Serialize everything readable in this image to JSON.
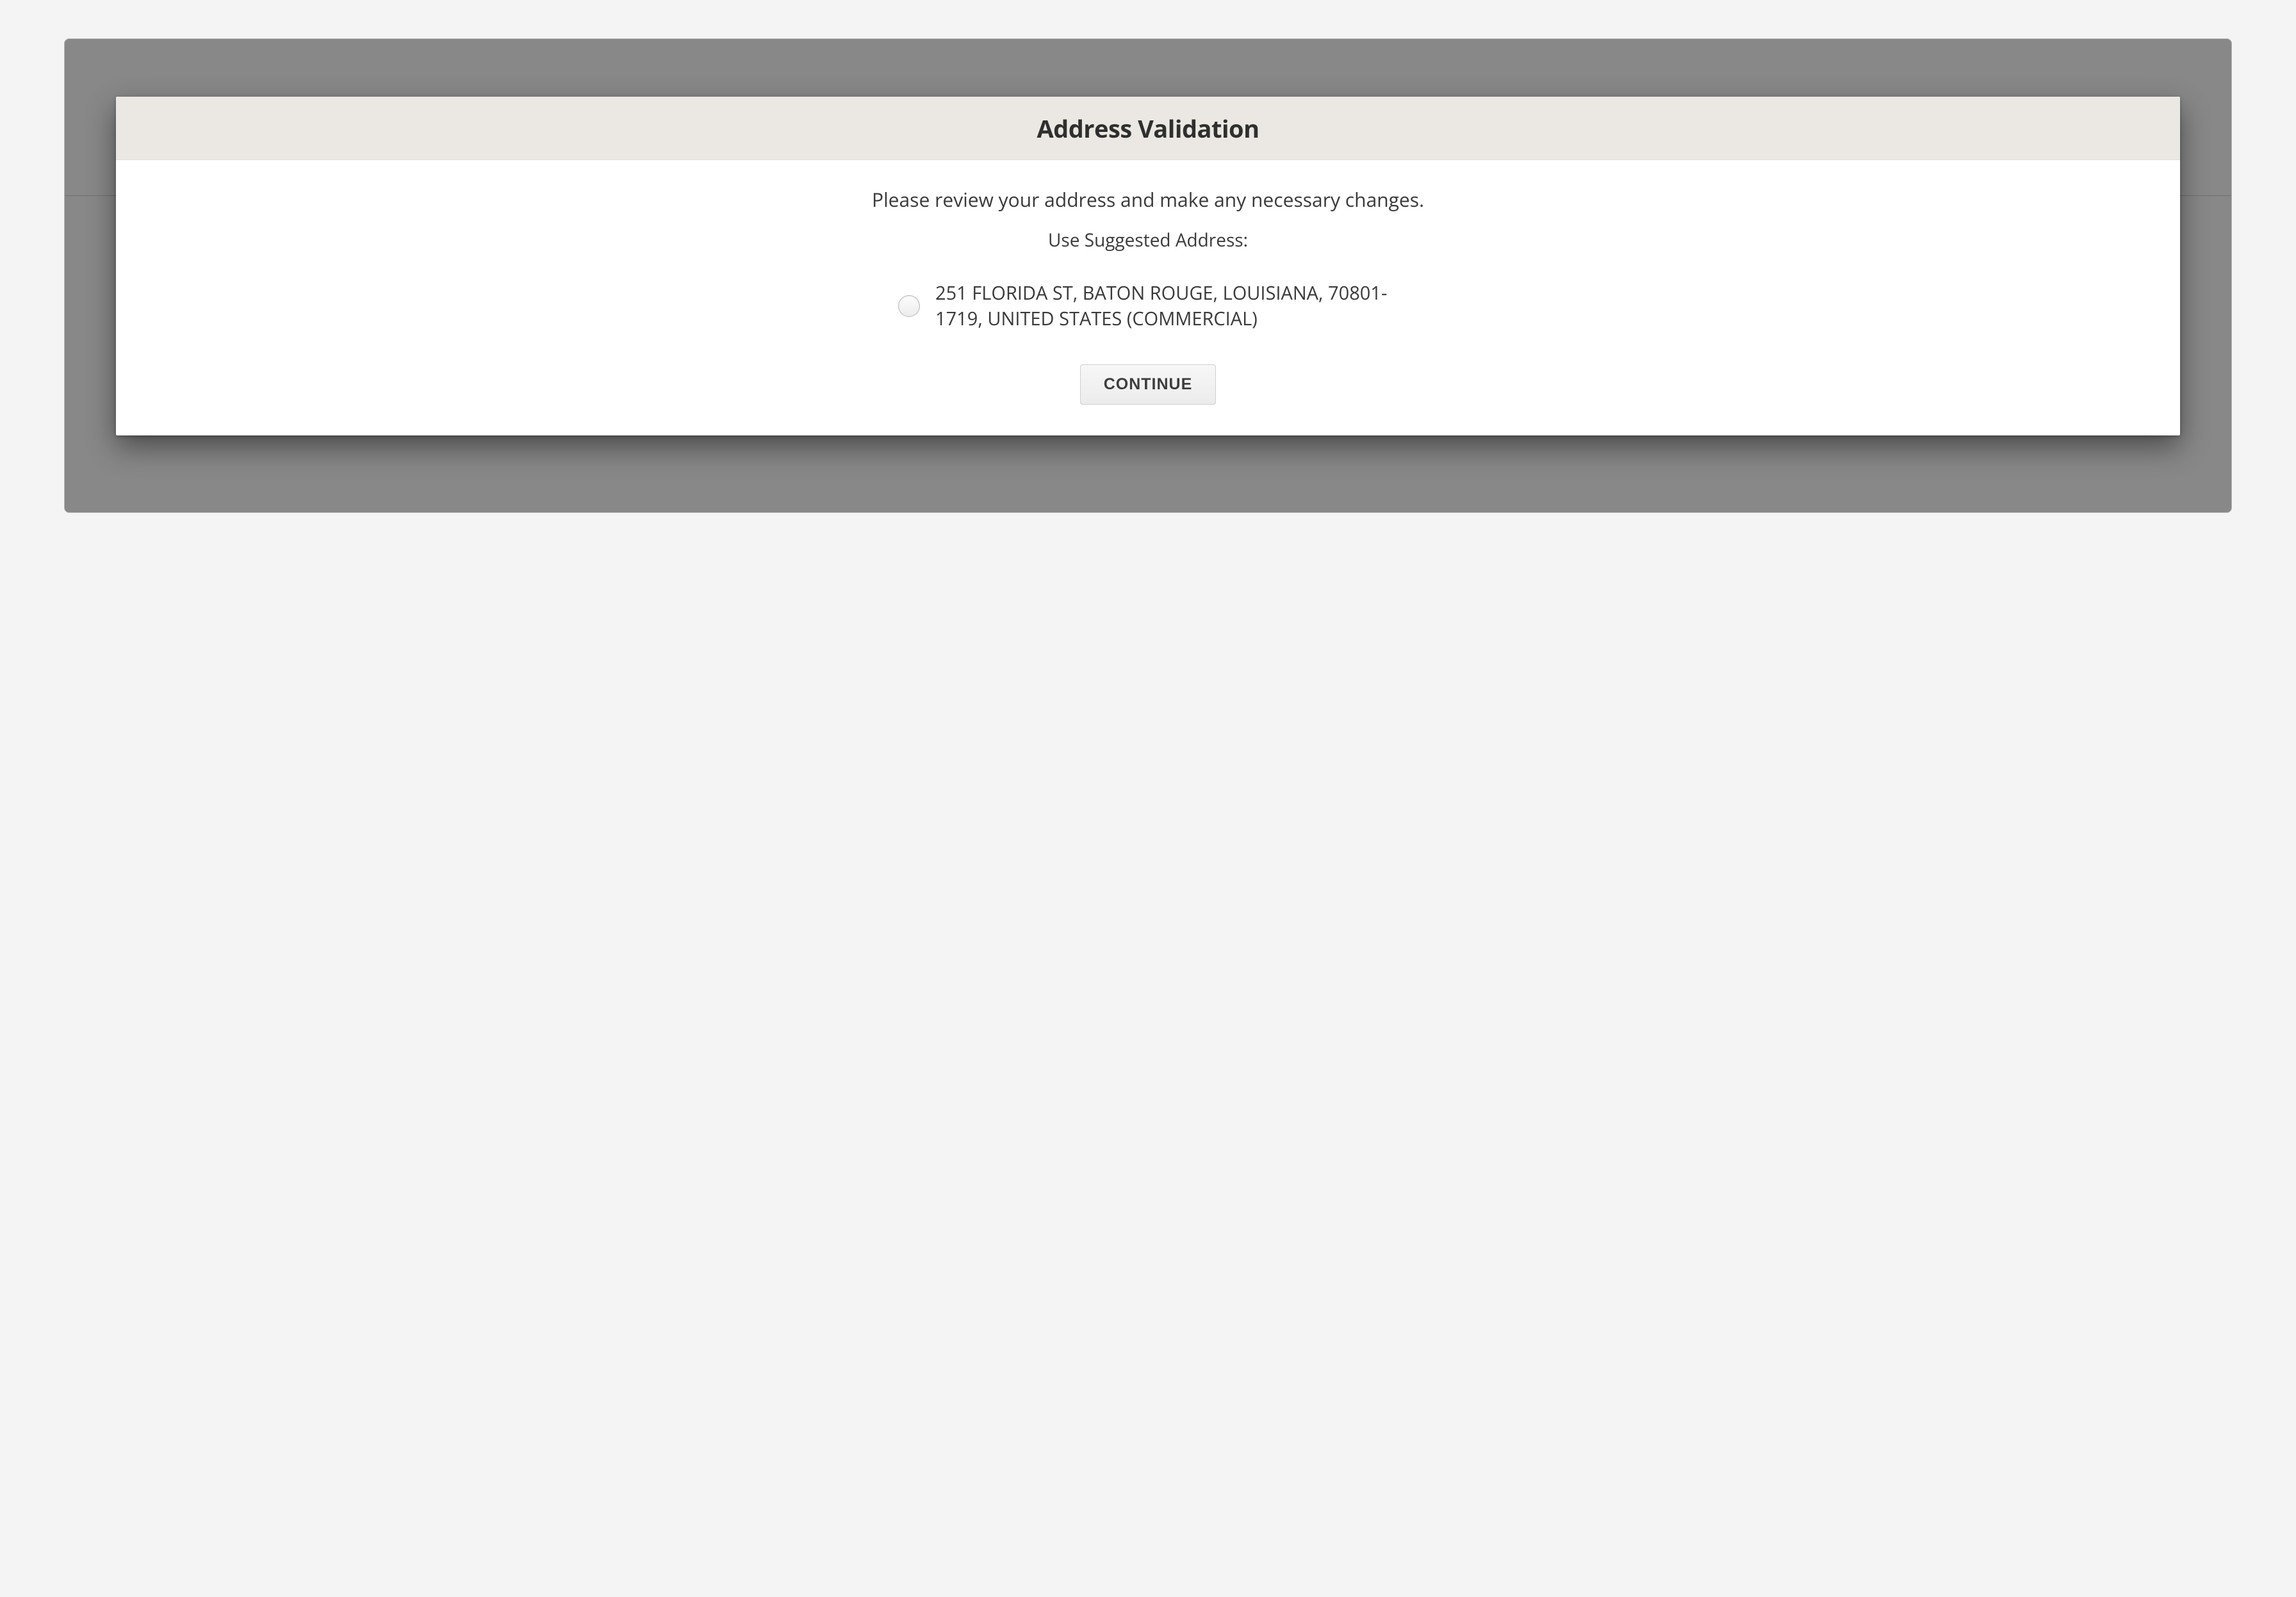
{
  "modal": {
    "title": "Address Validation",
    "instruction": "Please review your address and make any necessary changes.",
    "prompt": "Use Suggested Address:",
    "option_address": "251 FLORIDA ST, BATON ROUGE, LOUISIANA, 70801-1719, UNITED STATES (COMMERCIAL)",
    "continue_label": "CONTINUE"
  }
}
